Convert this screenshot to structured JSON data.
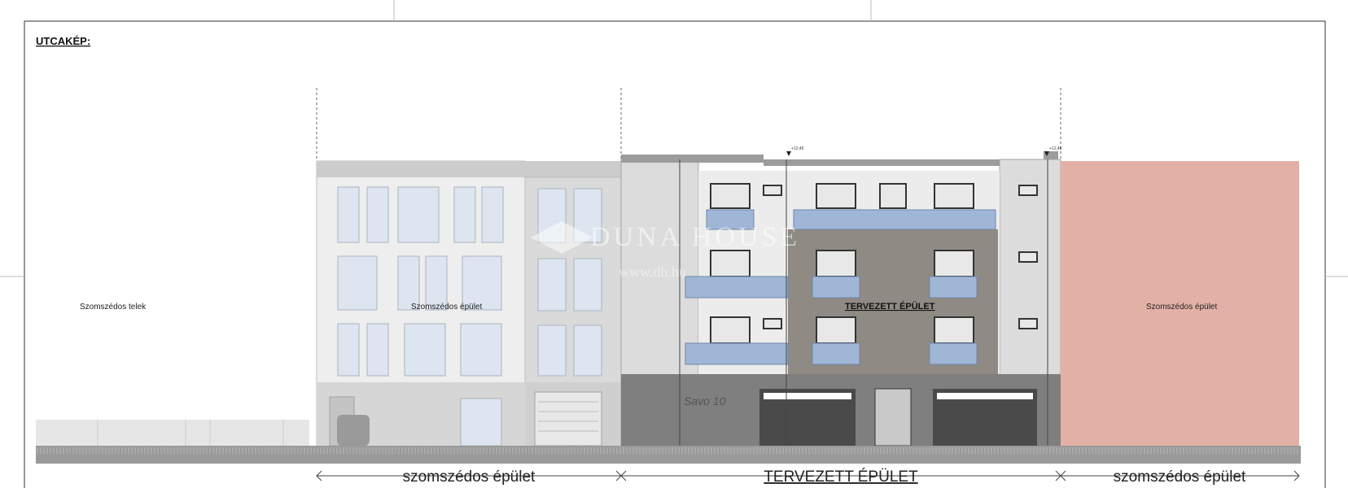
{
  "title": "UTCAKÉP:",
  "labels": {
    "neighbor_plot": "Szomszédos telek",
    "neighbor_building_left": "Szomszédos épület",
    "planned_building": "TERVEZETT ÉPÜLET",
    "neighbor_building_right": "Szomszédos épület",
    "street_number": "Savo 10"
  },
  "dimension_labels": {
    "left": "szomszédos épület",
    "center": "TERVEZETT ÉPÜLET",
    "right": "szomszédos épület"
  },
  "levels": {
    "top_left": "+12,45",
    "top_right": "+12,45"
  },
  "watermark": {
    "brand": "DUNA HOUSE",
    "url": "www.dh.hu"
  },
  "colors": {
    "neighbor_right_fill": "#e3b0a6",
    "planned_wall_dark": "#8f8a84",
    "planned_wall_light": "#dcdcdc",
    "glass": "#9fb6d6",
    "ground": "#9a9a9a"
  }
}
